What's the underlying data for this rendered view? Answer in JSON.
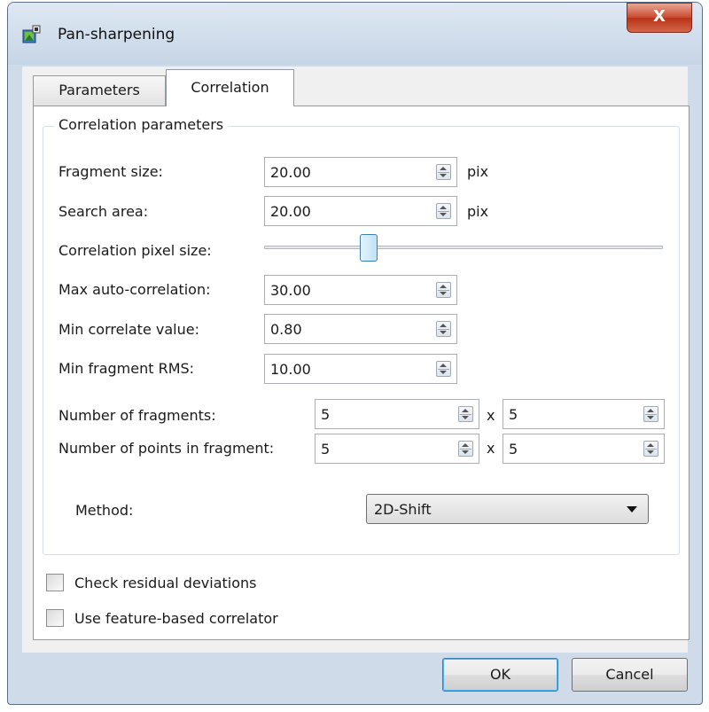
{
  "window": {
    "title": "Pan-sharpening",
    "close_glyph": "X"
  },
  "tabs": [
    {
      "label": "Parameters",
      "active": false
    },
    {
      "label": "Correlation",
      "active": true
    }
  ],
  "group": {
    "title": "Correlation parameters",
    "fragment_size": {
      "label": "Fragment size:",
      "value": "20.00",
      "unit": "pix"
    },
    "search_area": {
      "label": "Search area:",
      "value": "20.00",
      "unit": "pix"
    },
    "correlation_pixel_size": {
      "label": "Correlation pixel size:",
      "slider_fraction": 0.25
    },
    "max_auto_correlation": {
      "label": "Max auto-correlation:",
      "value": "30.00"
    },
    "min_correlate_value": {
      "label": "Min correlate value:",
      "value": "0.80"
    },
    "min_fragment_rms": {
      "label": "Min fragment RMS:",
      "value": "10.00"
    },
    "number_of_fragments": {
      "label": "Number of fragments:",
      "x_value": "5",
      "separator": "x",
      "y_value": "5"
    },
    "points_in_fragment": {
      "label": "Number of points in fragment:",
      "x_value": "5",
      "separator": "x",
      "y_value": "5"
    },
    "method": {
      "label": "Method:",
      "selected": "2D-Shift"
    }
  },
  "checkboxes": {
    "check_residual": {
      "label": "Check residual deviations",
      "checked": false
    },
    "feature_based": {
      "label": "Use feature-based correlator",
      "checked": false
    }
  },
  "buttons": {
    "ok": "OK",
    "cancel": "Cancel"
  },
  "colors": {
    "title_bar": "#cfdbe9",
    "close_button": "#c8492f",
    "focus_border": "#3c7fb1"
  }
}
